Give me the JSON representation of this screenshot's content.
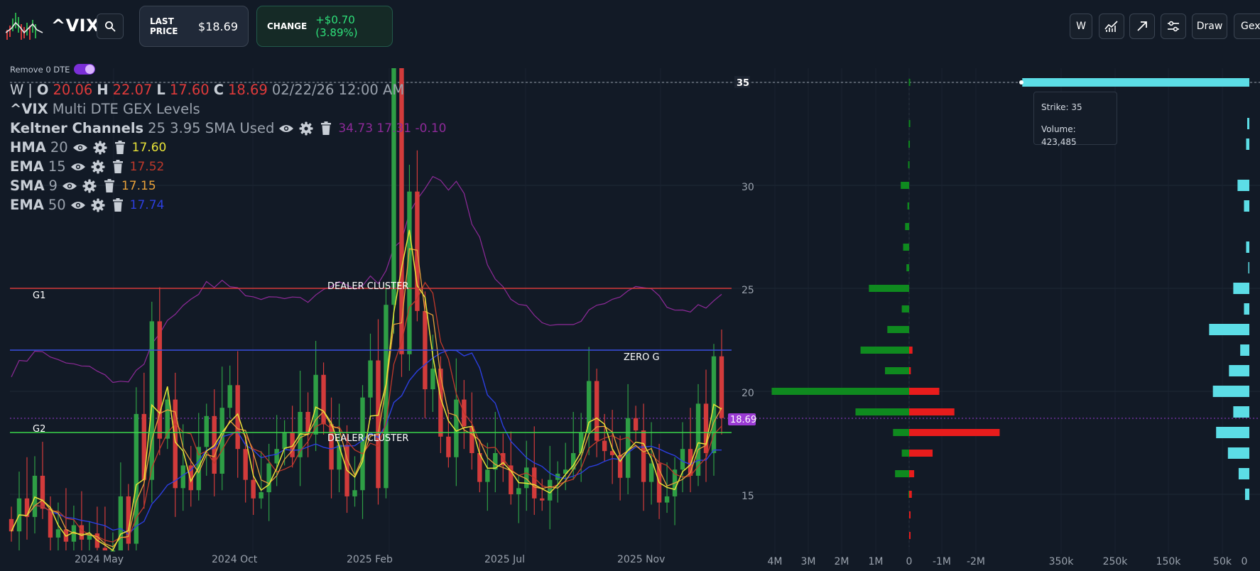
{
  "header": {
    "ticker": "^VIX",
    "last_price_label": "LAST PRICE",
    "last_price": "$18.69",
    "change_label": "CHANGE",
    "change_value": "+$0.70 (3.89%)",
    "toolbar": {
      "interval": "W",
      "draw": "Draw",
      "gex": "Gex"
    },
    "icons": [
      "logo-icon",
      "search-icon",
      "indicators-icon",
      "trend-arrow-icon",
      "settings-sliders-icon"
    ]
  },
  "toggle": {
    "label": "Remove 0 DTE",
    "on": true
  },
  "ohlc": {
    "interval": "W",
    "open_label": "O",
    "open": "20.06",
    "high_label": "H",
    "high": "22.07",
    "low_label": "L",
    "low": "17.60",
    "close_label": "C",
    "close": "18.69",
    "datetime": "02/22/26 12:00 AM"
  },
  "legend": {
    "title_symbol": "^VIX",
    "title_rest": "Multi DTE GEX Levels",
    "indicators": [
      {
        "name": "Keltner Channels",
        "params": "25 3.95 SMA Used",
        "values": "34.73 17.31 -0.10",
        "color": "#8e2a99"
      },
      {
        "name": "HMA",
        "params": "20",
        "values": "17.60",
        "color": "#e8e338"
      },
      {
        "name": "EMA",
        "params": "15",
        "values": "17.52",
        "color": "#c0392b"
      },
      {
        "name": "SMA",
        "params": "9",
        "values": "17.15",
        "color": "#e8a13a"
      },
      {
        "name": "EMA",
        "params": "50",
        "values": "17.74",
        "color": "#2c3fe0"
      }
    ]
  },
  "levels": {
    "g1_label": "G1",
    "g1_value": 25,
    "g1_name": "DEALER CLUSTER",
    "zero_g_label": "ZERO G",
    "zero_g_value": 22,
    "g2_label": "G2",
    "g2_value": 18,
    "g2_name": "DEALER CLUSTER"
  },
  "price_axis": {
    "ticks": [
      "35",
      "30",
      "25",
      "20",
      "15"
    ],
    "current_price_tag": "18.69",
    "highlight_strike": "35"
  },
  "time_axis": {
    "labels": [
      "2024 May",
      "2024 Oct",
      "2025 Feb",
      "2025 Jul",
      "2025 Nov"
    ]
  },
  "gex_axis": {
    "labels": [
      "4M",
      "3M",
      "2M",
      "1M",
      "0",
      "-1M",
      "-2M"
    ]
  },
  "volume_axis": {
    "labels": [
      "350k",
      "250k",
      "150k",
      "50k",
      "0"
    ]
  },
  "tooltip": {
    "strike_label": "Strike: 35",
    "volume_label": "Volume: 423,485"
  },
  "chart_data": {
    "type": "candlestick",
    "title": "^VIX Multi DTE GEX Levels",
    "ylim": [
      12.5,
      36
    ],
    "y_ticks": [
      15,
      20,
      25,
      30,
      35
    ],
    "x_labels": [
      "2024 May",
      "2024 Oct",
      "2025 Feb",
      "2025 Jul",
      "2025 Nov"
    ],
    "closes": [
      13.2,
      14.8,
      13.9,
      15.9,
      14.3,
      12.9,
      13.3,
      12.7,
      13.5,
      12.8,
      13.1,
      12.4,
      12.1,
      12.2,
      14.9,
      12.6,
      18.9,
      15.7,
      23.4,
      17.7,
      19.6,
      15.3,
      16.4,
      15.2,
      17.3,
      18.8,
      16.0,
      19.2,
      20.3,
      17.2,
      15.7,
      14.8,
      15.1,
      16.5,
      17.2,
      18.0,
      16.8,
      19.0,
      17.9,
      20.8,
      18.4,
      16.2,
      17.4,
      14.9,
      15.2,
      19.7,
      21.5,
      15.3,
      24.2,
      45.3,
      21.8,
      29.7,
      23.9,
      20.1,
      21.1,
      17.8,
      16.8,
      19.6,
      18.3,
      17.0,
      15.6,
      16.2,
      17.0,
      16.4,
      15.0,
      15.3,
      16.3,
      14.8,
      14.7,
      15.7,
      16.0,
      16.2,
      17.0,
      18.0,
      20.5,
      17.6,
      17.1,
      16.9,
      15.8,
      18.7,
      18.1,
      15.6,
      16.5,
      14.6,
      14.9,
      16.2,
      17.2,
      15.9,
      19.4,
      17.0,
      21.7,
      18.7
    ],
    "gex_strikes": [
      35,
      34,
      33,
      32,
      31,
      30,
      29,
      28,
      27,
      26,
      25,
      24,
      23,
      22,
      21,
      20,
      19,
      18,
      17,
      16,
      15,
      14,
      13
    ],
    "gex_positive_millions": [
      0.01,
      0,
      0.01,
      0.02,
      0.03,
      0.25,
      0.05,
      0.12,
      0.18,
      0.08,
      1.2,
      0.22,
      0.65,
      1.45,
      0.72,
      4.1,
      1.6,
      0.48,
      0.22,
      0.42,
      0.02,
      0,
      0
    ],
    "gex_negative_millions": [
      0,
      0,
      0,
      0,
      0,
      0,
      0,
      0,
      0,
      0,
      0,
      0,
      0,
      0.1,
      0.05,
      0.9,
      1.35,
      2.7,
      0.7,
      0.15,
      0.08,
      0.04,
      0.03
    ],
    "volume_k": [
      423.485,
      0,
      4,
      6,
      0,
      22,
      10,
      0,
      6,
      2,
      30,
      10,
      75,
      17,
      38,
      68,
      30,
      62,
      40,
      20,
      8,
      0,
      0
    ]
  }
}
